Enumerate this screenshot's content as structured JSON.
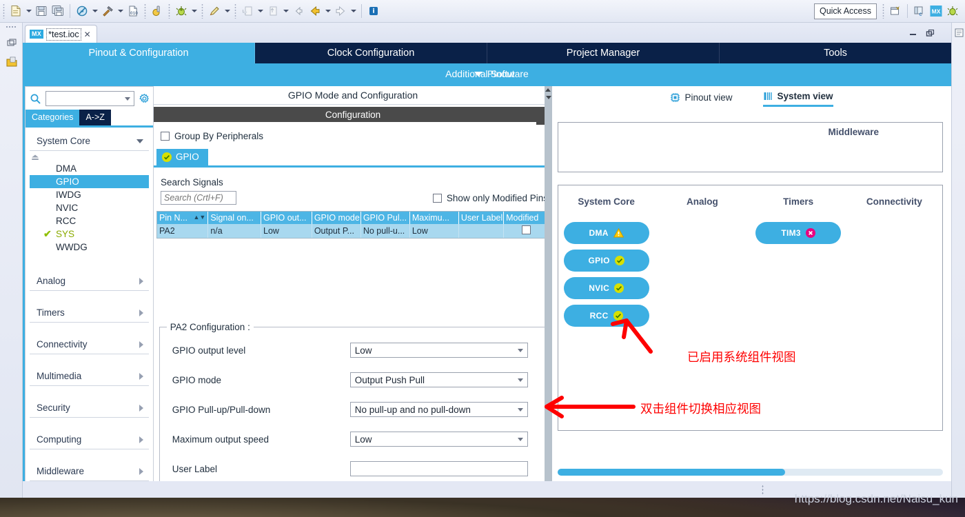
{
  "colors": {
    "cube_blue": "#3dafe2",
    "cube_dark": "#0a2148",
    "annotation_red": "#fe0000",
    "chip_blue": "#3dafe2",
    "ok_yellow": "#d7e000",
    "error_magenta": "#e8007f",
    "warn_amber": "#ffcc00",
    "band_gray": "#4a4a4a",
    "table_header": "#4db5e5",
    "table_row": "#a8d8ef"
  },
  "toolbar": {
    "icons": [
      "new-file-icon",
      "dropdown-arrow",
      "save-icon",
      "save-all-icon",
      "no-build-icon",
      "dropdown-arrow",
      "build-hammer-icon",
      "dropdown-arrow",
      "binary-file-icon",
      "debug-configure-icon",
      "debug-bug-icon",
      "dropdown-arrow",
      "pencil-run-icon",
      "dropdown-arrow",
      "import-icon",
      "dropdown-arrow",
      "export-icon",
      "dropdown-arrow",
      "back-small-icon",
      "back-arrow-icon",
      "dropdown-arrow",
      "forward-arrow-icon",
      "dropdown-arrow",
      "info-icon"
    ],
    "quick_access_label": "Quick Access",
    "right_icons": [
      "open-perspective-icon",
      "c-perspective-icon",
      "mx-perspective-icon",
      "debug-perspective-icon"
    ]
  },
  "left_rail": {
    "icons": [
      "restore-icon",
      "project-explorer-icon"
    ]
  },
  "right_rail": {
    "icons": [
      "outline-icon"
    ]
  },
  "editor_tab": {
    "badge": "MX",
    "name": "*test.ioc",
    "close": "✕"
  },
  "window_controls": {
    "minimize": "minimize-icon",
    "maximize": "maximize-icon"
  },
  "main_tabs": [
    {
      "label": "Pinout & Configuration",
      "active": true
    },
    {
      "label": "Clock Configuration",
      "active": false
    },
    {
      "label": "Project Manager",
      "active": false
    },
    {
      "label": "Tools",
      "active": false
    }
  ],
  "sub_bar": {
    "additional_software": "Additional Software",
    "pinout_toggle": "Pinout"
  },
  "sidebar": {
    "search": {
      "value": "",
      "placeholder": ""
    },
    "gear_icon": "gear-icon",
    "search_icon": "search-icon",
    "tabs": [
      {
        "label": "Categories",
        "selected": true
      },
      {
        "label": "A->Z",
        "selected": false
      }
    ],
    "groups": [
      {
        "label": "System Core",
        "expanded": true,
        "items": [
          {
            "label": "DMA",
            "selected": false,
            "configured": false
          },
          {
            "label": "GPIO",
            "selected": true,
            "configured": false
          },
          {
            "label": "IWDG",
            "selected": false,
            "configured": false
          },
          {
            "label": "NVIC",
            "selected": false,
            "configured": false
          },
          {
            "label": "RCC",
            "selected": false,
            "configured": false
          },
          {
            "label": "SYS",
            "selected": false,
            "configured": true
          },
          {
            "label": "WWDG",
            "selected": false,
            "configured": false
          }
        ]
      },
      {
        "label": "Analog",
        "expanded": false,
        "items": []
      },
      {
        "label": "Timers",
        "expanded": false,
        "items": []
      },
      {
        "label": "Connectivity",
        "expanded": false,
        "items": []
      },
      {
        "label": "Multimedia",
        "expanded": false,
        "items": []
      },
      {
        "label": "Security",
        "expanded": false,
        "items": []
      },
      {
        "label": "Computing",
        "expanded": false,
        "items": []
      },
      {
        "label": "Middleware",
        "expanded": false,
        "items": []
      }
    ]
  },
  "center": {
    "mode_title": "GPIO Mode and Configuration",
    "configuration_band": "Configuration",
    "group_by_peripherals": {
      "label": "Group By Peripherals",
      "checked": false
    },
    "peripheral_tab": {
      "label": "GPIO",
      "status": "ok"
    },
    "search_signals_label": "Search Signals",
    "search_signals_input": {
      "value": "",
      "placeholder": "Search (Crtl+F)"
    },
    "show_only_modified": {
      "label": "Show only Modified Pins",
      "checked": false
    },
    "table": {
      "columns": [
        "Pin N...",
        "Signal on...",
        "GPIO out...",
        "GPIO mode",
        "GPIO Pul...",
        "Maximu...",
        "User Label",
        "Modified"
      ],
      "sort_column": 0,
      "rows": [
        {
          "pin": "PA2",
          "signal": "n/a",
          "output": "Low",
          "mode": "Output P...",
          "pull": "No pull-u...",
          "maximum": "Low",
          "user_label": "",
          "modified": false
        }
      ]
    },
    "pin_config": {
      "legend": "PA2 Configuration :",
      "fields": [
        {
          "label": "GPIO output level",
          "value": "Low",
          "type": "select"
        },
        {
          "label": "GPIO mode",
          "value": "Output Push Pull",
          "type": "select"
        },
        {
          "label": "GPIO Pull-up/Pull-down",
          "value": "No pull-up and no pull-down",
          "type": "select"
        },
        {
          "label": "Maximum output speed",
          "value": "Low",
          "type": "select"
        },
        {
          "label": "User Label",
          "value": "",
          "type": "text"
        }
      ]
    }
  },
  "right": {
    "view_tabs": [
      {
        "label": "Pinout view",
        "icon": "chip-icon",
        "active": false
      },
      {
        "label": "System view",
        "icon": "system-icon",
        "active": true
      }
    ],
    "middleware_label": "Middleware",
    "system_columns": [
      {
        "header": "System Core",
        "chips": [
          {
            "label": "DMA",
            "status": "warning"
          },
          {
            "label": "GPIO",
            "status": "ok"
          },
          {
            "label": "NVIC",
            "status": "ok"
          },
          {
            "label": "RCC",
            "status": "ok"
          }
        ]
      },
      {
        "header": "Analog",
        "chips": []
      },
      {
        "header": "Timers",
        "chips": [
          {
            "label": "TIM3",
            "status": "error"
          }
        ]
      },
      {
        "header": "Connectivity",
        "chips": []
      }
    ],
    "scroll_position_percent": 59,
    "annotations": [
      {
        "text": "已启用系统组件视图",
        "kind": "label"
      },
      {
        "text": "双击组件切换相应视图",
        "kind": "label"
      }
    ]
  },
  "status_bar": {
    "watermark": "https://blog.csdn.net/Naisu_kun"
  }
}
